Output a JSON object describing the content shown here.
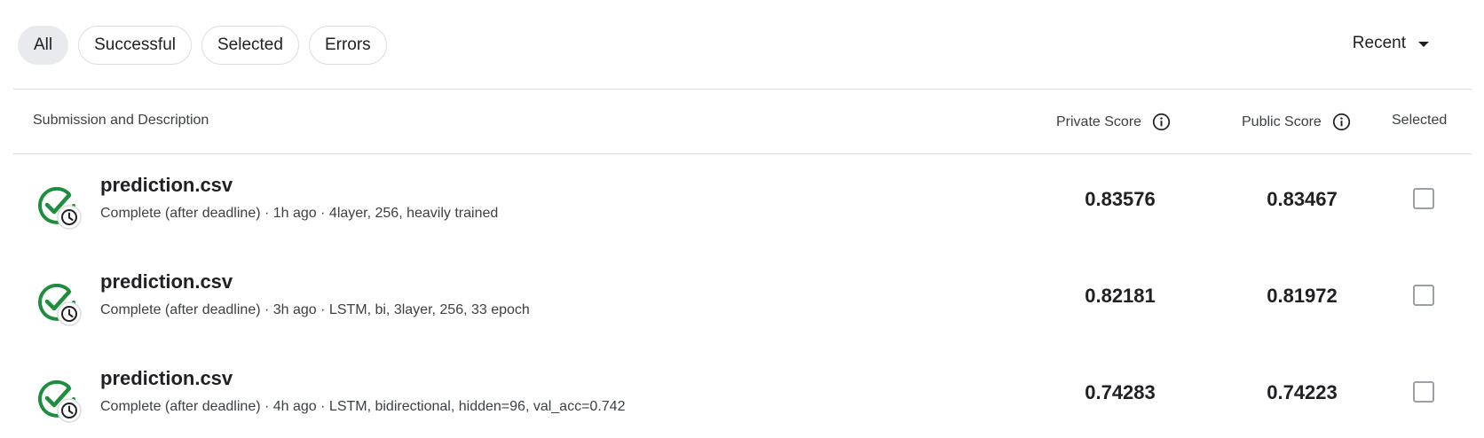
{
  "filters": {
    "all": "All",
    "successful": "Successful",
    "selected": "Selected",
    "errors": "Errors"
  },
  "sort": {
    "label": "Recent"
  },
  "table": {
    "headers": {
      "submission": "Submission and Description",
      "private": "Private Score",
      "public": "Public Score",
      "selected": "Selected"
    },
    "rows": [
      {
        "file": "prediction.csv",
        "description": "Complete (after deadline) · 1h ago · 4layer, 256, heavily trained",
        "private_score": "0.83576",
        "public_score": "0.83467",
        "selected": false
      },
      {
        "file": "prediction.csv",
        "description": "Complete (after deadline) · 3h ago · LSTM, bi, 3layer, 256, 33 epoch",
        "private_score": "0.82181",
        "public_score": "0.81972",
        "selected": false
      },
      {
        "file": "prediction.csv",
        "description": "Complete (after deadline) · 4h ago · LSTM, bidirectional, hidden=96, val_acc=0.742",
        "private_score": "0.74283",
        "public_score": "0.74223",
        "selected": false
      }
    ]
  },
  "colors": {
    "success": "#1e8e3e",
    "chip_active": "#e8eaed",
    "border": "#dadce0"
  },
  "icons": {
    "status": "check-circle-clock-icon",
    "info": "info-icon",
    "sort": "caret-down-icon"
  }
}
